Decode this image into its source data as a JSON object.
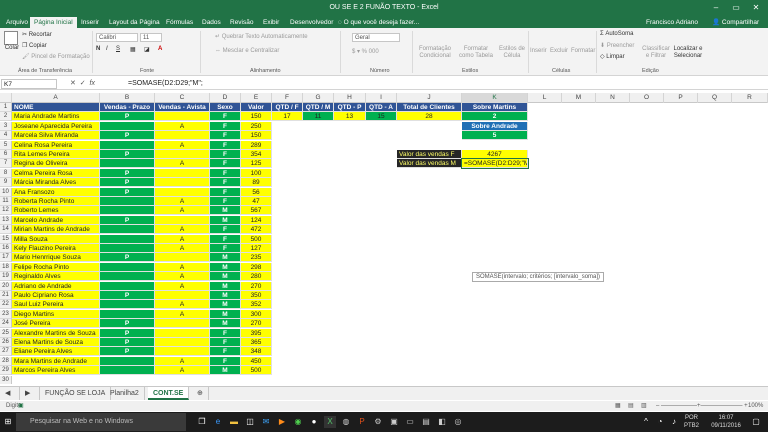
{
  "window": {
    "title": "OU SE E 2 FUNÃO TEXTO - Excel"
  },
  "menu": {
    "tabs": [
      "Arquivo",
      "Página Inicial",
      "Inserir",
      "Layout da Página",
      "Fórmulas",
      "Dados",
      "Revisão",
      "Exibir",
      "Desenvolvedor"
    ],
    "tell_me": "O que você deseja fazer...",
    "user": "Francisco Adriano",
    "share": "Compartilhar"
  },
  "ribbon": {
    "recortar": "Recortar",
    "copiar": "Copiar",
    "pincel": "Pincel de Formatação",
    "colar": "Colar",
    "grp_clip": "Área de Transferência",
    "font_name": "Calibri",
    "font_size": "11",
    "grp_font": "Fonte",
    "quebrar": "Quebrar Texto Automaticamente",
    "mesclar": "Mesclar e Centralizar",
    "grp_align": "Alinhamento",
    "number_format": "Geral",
    "grp_number": "Número",
    "cond": "Formatação Condicional",
    "fmt_tab": "Formatar como Tabela",
    "estilos": "Estilos de Célula",
    "grp_styles": "Estilos",
    "inserir": "Inserir",
    "excluir": "Excluir",
    "formatar": "Formatar",
    "grp_cells": "Células",
    "autosoma": "AutoSoma",
    "preencher": "Preencher",
    "limpar": "Limpar",
    "classificar": "Classificar e Filtrar",
    "localizar": "Localizar e Selecionar",
    "grp_edit": "Edição"
  },
  "formula_bar": {
    "name_box": "K7",
    "formula": "=SOMASE(D2:D29;\"M\";"
  },
  "columns": [
    "A",
    "B",
    "C",
    "D",
    "E",
    "F",
    "G",
    "H",
    "I",
    "J",
    "K",
    "L",
    "M",
    "N",
    "O",
    "P",
    "Q",
    "R"
  ],
  "headers": {
    "nome": "NOME",
    "prazo": "Vendas - Prazo",
    "avista": "Vendas - Avista",
    "sexo": "Sexo",
    "valor": "Valor",
    "qtdf": "QTD / F",
    "qtdm": "QTD / M",
    "qtdp": "QTD - P",
    "qtda": "QTD - A",
    "total": "Total de Clientes",
    "sobre": "Sobre Martins"
  },
  "row2_stats": {
    "f": "17",
    "g": "11",
    "h": "13",
    "i": "15",
    "j": "28",
    "k": "2"
  },
  "k3": "Sobre Andrade",
  "k4": "5",
  "sum_f_label": "Valor das vendas F",
  "sum_f_value": "4267",
  "sum_m_label": "Valor das vendas M",
  "sum_m_formula": "=SOMASE(D2:D29;\"M\";",
  "tooltip": "SOMASE(intervalo; critérios; [intervalo_soma])",
  "rows": [
    {
      "n": "Maria Andrade Martins",
      "p": "P",
      "a": "",
      "s": "F",
      "v": "150"
    },
    {
      "n": "Joseane Aparecida Pereira",
      "p": "",
      "a": "A",
      "s": "F",
      "v": "250"
    },
    {
      "n": "Marcela Silva Miranda",
      "p": "P",
      "a": "",
      "s": "F",
      "v": "150"
    },
    {
      "n": "Celina Rosa Pereira",
      "p": "",
      "a": "A",
      "s": "F",
      "v": "289"
    },
    {
      "n": "Rita Lemes Pereira",
      "p": "P",
      "a": "",
      "s": "F",
      "v": "354"
    },
    {
      "n": "Regina de Oliveira",
      "p": "",
      "a": "A",
      "s": "F",
      "v": "125"
    },
    {
      "n": "Celma Pereira Rosa",
      "p": "P",
      "a": "",
      "s": "F",
      "v": "100"
    },
    {
      "n": "Márcia Miranda Alves",
      "p": "P",
      "a": "",
      "s": "F",
      "v": "89"
    },
    {
      "n": "Ana Fransozo",
      "p": "P",
      "a": "",
      "s": "F",
      "v": "56"
    },
    {
      "n": "Roberta Rocha Pinto",
      "p": "",
      "a": "A",
      "s": "F",
      "v": "47"
    },
    {
      "n": "Roberto Lemes",
      "p": "",
      "a": "A",
      "s": "M",
      "v": "567"
    },
    {
      "n": "Marcelo Andrade",
      "p": "P",
      "a": "",
      "s": "M",
      "v": "124"
    },
    {
      "n": "Mirian Martins de Andrade",
      "p": "",
      "a": "A",
      "s": "F",
      "v": "472"
    },
    {
      "n": "Milla Souza",
      "p": "",
      "a": "A",
      "s": "F",
      "v": "500"
    },
    {
      "n": "Kely Flauzino Pereira",
      "p": "",
      "a": "A",
      "s": "F",
      "v": "127"
    },
    {
      "n": "Mario Henrrique Souza",
      "p": "P",
      "a": "",
      "s": "M",
      "v": "235"
    },
    {
      "n": "Felipe Rocha Pinto",
      "p": "",
      "a": "A",
      "s": "M",
      "v": "298"
    },
    {
      "n": "Reginaldo Alves",
      "p": "",
      "a": "A",
      "s": "M",
      "v": "280"
    },
    {
      "n": "Adriano de Andrade",
      "p": "",
      "a": "A",
      "s": "M",
      "v": "270"
    },
    {
      "n": "Paulo Cipriano Rosa",
      "p": "P",
      "a": "",
      "s": "M",
      "v": "350"
    },
    {
      "n": "Saul Luiz Pereira",
      "p": "",
      "a": "A",
      "s": "M",
      "v": "352"
    },
    {
      "n": "Diego Martins",
      "p": "",
      "a": "A",
      "s": "M",
      "v": "300"
    },
    {
      "n": "José Pereira",
      "p": "P",
      "a": "",
      "s": "M",
      "v": "270"
    },
    {
      "n": "Alexandre Martins de Souza",
      "p": "P",
      "a": "",
      "s": "F",
      "v": "395"
    },
    {
      "n": "Elena Martins de Souza",
      "p": "P",
      "a": "",
      "s": "F",
      "v": "365"
    },
    {
      "n": "Eliane Pereira Alves",
      "p": "P",
      "a": "",
      "s": "F",
      "v": "348"
    },
    {
      "n": "Mara Martins de Andrade",
      "p": "",
      "a": "A",
      "s": "F",
      "v": "450"
    },
    {
      "n": "Marcos Pereira Alves",
      "p": "",
      "a": "A",
      "s": "M",
      "v": "500"
    }
  ],
  "sheets": [
    "FUNÇÃO SE LOJA",
    "Planilha2",
    "CONT.SE"
  ],
  "status": {
    "mode": "Digite",
    "zoom": "100%"
  },
  "taskbar": {
    "search": "Pesquisar na Web e no Windows",
    "lang": "POR",
    "kbd": "PTB2",
    "time": "16:07",
    "date": "09/11/2016"
  }
}
